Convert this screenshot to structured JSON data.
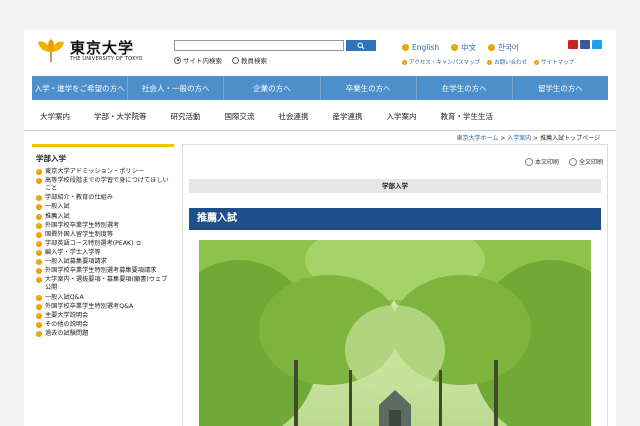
{
  "logo": {
    "jp": "東京大学",
    "en": "THE UNIVERSITY OF TOKYO"
  },
  "search": {
    "placeholder": "",
    "radio1": "サイト内検索",
    "radio2": "教員検索"
  },
  "langs": [
    {
      "label": "English"
    },
    {
      "label": "中文"
    },
    {
      "label": "한국어"
    }
  ],
  "sublinks": [
    {
      "label": "アクセス・キャンパスマップ"
    },
    {
      "label": "お問い合わせ"
    },
    {
      "label": "サイトマップ"
    }
  ],
  "bluenav": [
    {
      "label": "入学・進学をご希望の方へ"
    },
    {
      "label": "社会人・一般の方へ"
    },
    {
      "label": "企業の方へ"
    },
    {
      "label": "卒業生の方へ"
    },
    {
      "label": "在学生の方へ"
    },
    {
      "label": "留学生の方へ"
    }
  ],
  "mainnav": [
    {
      "label": "大学案内"
    },
    {
      "label": "学部・大学院等"
    },
    {
      "label": "研究活動"
    },
    {
      "label": "国際交流"
    },
    {
      "label": "社会連携"
    },
    {
      "label": "産学連携"
    },
    {
      "label": "入学案内"
    },
    {
      "label": "教育・学生生活"
    }
  ],
  "breadcrumb": {
    "home": "東京大学ホーム",
    "sep": " > ",
    "mid": "入学案内",
    "current": "推薦入試トップページ"
  },
  "sidebar": {
    "title": "学部入学",
    "items": [
      {
        "label": "東京大学アドミッション・ポリシー"
      },
      {
        "label": "高等学校段階までの学習で身につけてほしいこと"
      },
      {
        "label": "学部紹介・教育の仕組み"
      },
      {
        "label": "一般入試"
      },
      {
        "label": "推薦入試"
      },
      {
        "label": "外国学校卒業学生特別選考"
      },
      {
        "label": "国費外国人留学生制度等"
      },
      {
        "label": "学部英語コース特別選考(PEAK)",
        "ext": "⧉"
      },
      {
        "label": "編入学・学士入学等"
      },
      {
        "label": "一般入試募集要項請求"
      },
      {
        "label": "外国学校卒業学生特別選考募集要項請求"
      },
      {
        "label": "大学案内・選抜要項・募集要項(願書)ウェブ公開"
      },
      {
        "label": "一般入試Q&A"
      },
      {
        "label": "外国学校卒業学生特別選考Q&A"
      },
      {
        "label": "主要大学説明会"
      },
      {
        "label": "その他の説明会"
      },
      {
        "label": "過去の試験問題"
      }
    ]
  },
  "content": {
    "print_text": "本文印刷",
    "print_all": "全文印刷",
    "section": "学部入学",
    "title": "推薦入試"
  },
  "colors": {
    "accent_blue": "#4d8fcb",
    "title_blue": "#1e4f8a",
    "bullet": "#e8a100",
    "sidebar_rule": "#f0c200"
  }
}
